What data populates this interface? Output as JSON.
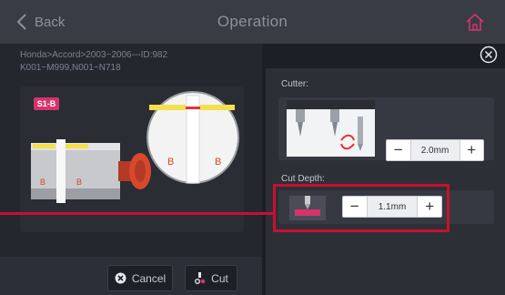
{
  "header": {
    "back_label": "Back",
    "title": "Operation"
  },
  "vehicle": {
    "line1": "Honda>Accord>2003~2006---ID:982",
    "line2": "K001~M999,N001~N718"
  },
  "preview": {
    "tag": "S1-B",
    "side_markers": [
      "B",
      "B",
      "B",
      "B"
    ]
  },
  "actions": {
    "cancel_label": "Cancel",
    "cut_label": "Cut"
  },
  "settings": {
    "cutter_label": "Cutter:",
    "cutter_value": "2.0mm",
    "depth_label": "Cut Depth:",
    "depth_value": "1.1mm",
    "minus": "−",
    "plus": "+"
  },
  "colors": {
    "accent_red": "#c8102e",
    "tag_pink": "#d6336c",
    "key_yellow": "#f4e04d",
    "knob_orange": "#d9482b"
  },
  "icons": {
    "back": "chevron-left-icon",
    "home": "home-icon",
    "close": "close-circle-icon",
    "cancel": "close-circle-icon",
    "cut": "cutter-icon"
  }
}
